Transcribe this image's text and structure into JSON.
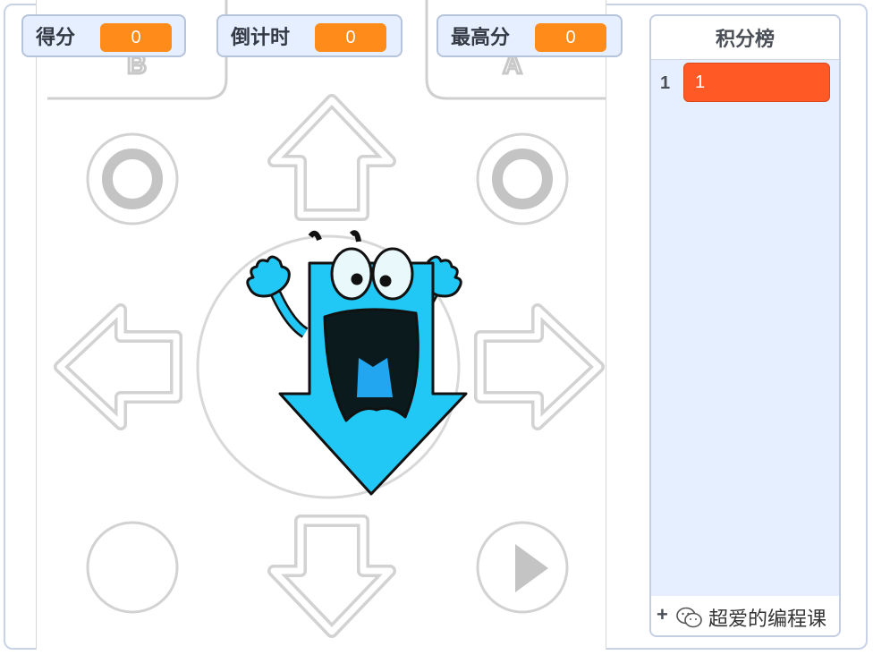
{
  "monitors": {
    "score": {
      "label": "得分",
      "value": "0"
    },
    "timer": {
      "label": "倒计时",
      "value": "0"
    },
    "best": {
      "label": "最高分",
      "value": "0"
    }
  },
  "leaderboard": {
    "title": "积分榜",
    "rows": [
      {
        "index": "1",
        "value": "1"
      }
    ],
    "add_symbol": "+"
  },
  "stage": {
    "buttons": {
      "b_letter": "B",
      "a_letter": "A"
    },
    "character": "down-arrow-monster"
  },
  "watermark": {
    "text": "超爱的编程课"
  },
  "colors": {
    "monitor_value": "#ff8c1a",
    "list_item": "#ff5a26",
    "arrow_blue": "#22c8f5",
    "panel_bg": "#e6efff"
  }
}
